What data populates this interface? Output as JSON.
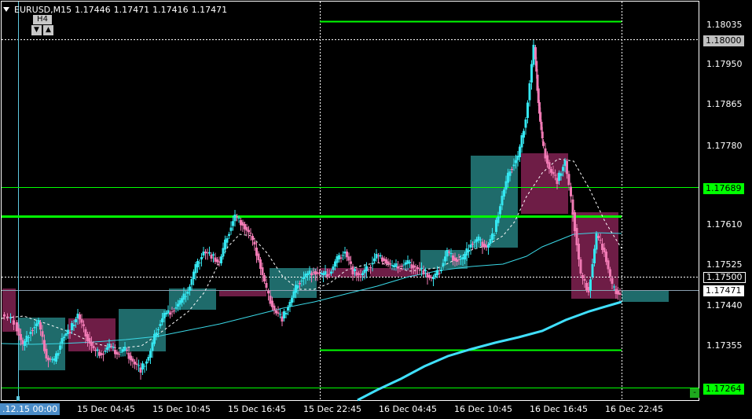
{
  "header": {
    "symbol_timeframe": "EURUSD,M15",
    "open": "1.17446",
    "high": "1.17471",
    "low": "1.17416",
    "close": "1.17471"
  },
  "timeframe_box": {
    "label": "H4",
    "down_icon": "▼",
    "up_icon": "▲"
  },
  "x_axis": {
    "first_label": ".12.15 00:00",
    "labels": [
      "15 Dec 04:45",
      "15 Dec 10:45",
      "15 Dec 16:45",
      "15 Dec 22:45",
      "16 Dec 04:45",
      "16 Dec 10:45",
      "16 Dec 16:45",
      "16 Dec 22:45"
    ]
  },
  "y_axis": {
    "labels": [
      "1.18035",
      "1.17950",
      "1.17865",
      "1.17780",
      "1.17610",
      "1.17525",
      "1.17440",
      "1.17355"
    ]
  },
  "price_tags": [
    {
      "text": "1.18000",
      "bg": "#c0c0c0",
      "fg": "#000000",
      "kind": "level"
    },
    {
      "text": "1.17689",
      "bg": "#00ff00",
      "fg": "#000000",
      "kind": "green-line"
    },
    {
      "text": "1.17500",
      "bg": "#000000",
      "fg": "#ffffff",
      "kind": "level"
    },
    {
      "text": "1.17471",
      "bg": "#ffffff",
      "fg": "#000000",
      "kind": "bid"
    },
    {
      "text": "1.17264",
      "bg": "#00ff00",
      "fg": "#000000",
      "kind": "green-line"
    }
  ],
  "corner_button": {
    "label": "-"
  },
  "colors": {
    "bull_candle": "#35e6f0",
    "bear_candle": "#f07ab4",
    "bull_box": "#1f6b6b",
    "bear_box": "#6e1d46",
    "green_line": "#00ff00",
    "ma_fast": "#ffffff",
    "ma_mid": "#3ad8e6",
    "ma_slow": "#40e0ff",
    "axis": "#ffffff"
  }
}
